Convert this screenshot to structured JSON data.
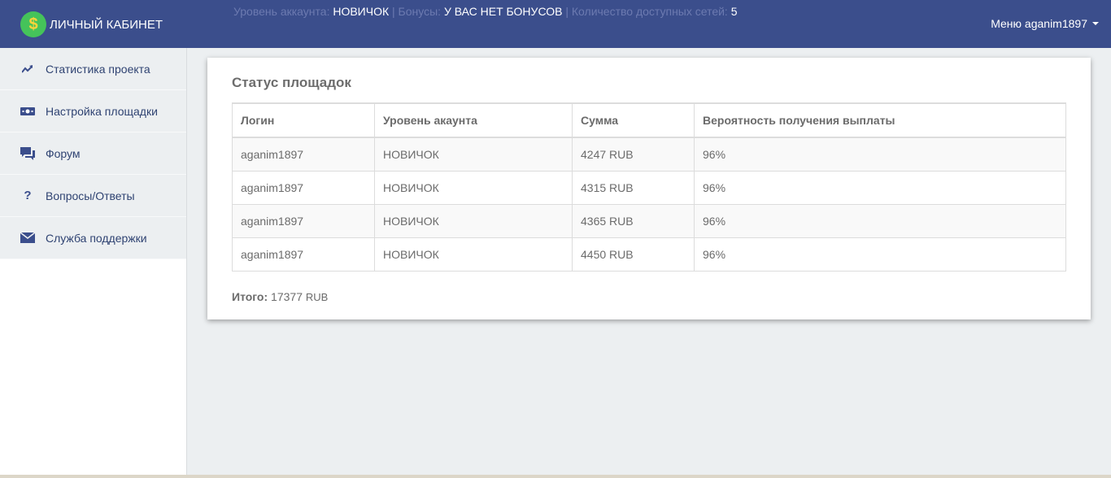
{
  "header": {
    "brand": "ЛИЧНЫЙ КАБИНЕТ",
    "brand_icon": "dollar-icon",
    "status": {
      "level_label": "Уровень аккаунта:",
      "level_value": "НОВИЧОК",
      "sep1": "|",
      "bonus_label": "Бонусы:",
      "bonus_value": "У ВАС НЕТ БОНУСОВ",
      "sep2": "|",
      "networks_label": "Количество доступных сетей:",
      "networks_value": "5"
    },
    "menu_label": "Меню aganim1897"
  },
  "sidebar": {
    "items": [
      {
        "label": "Статистика проекта",
        "icon": "trend-up-icon"
      },
      {
        "label": "Настройка площадки",
        "icon": "money-icon"
      },
      {
        "label": "Форум",
        "icon": "chat-icon"
      },
      {
        "label": "Вопросы/Ответы",
        "icon": "question-icon"
      },
      {
        "label": "Служба поддержки",
        "icon": "envelope-icon"
      }
    ]
  },
  "card": {
    "title": "Статус площадок",
    "columns": [
      "Логин",
      "Уровень акаунта",
      "Сумма",
      "Вероятность получения выплаты"
    ],
    "rows": [
      [
        "aganim1897",
        "НОВИЧОК",
        "4247 RUB",
        "96%"
      ],
      [
        "aganim1897",
        "НОВИЧОК",
        "4315 RUB",
        "96%"
      ],
      [
        "aganim1897",
        "НОВИЧОК",
        "4365 RUB",
        "96%"
      ],
      [
        "aganim1897",
        "НОВИЧОК",
        "4450 RUB",
        "96%"
      ]
    ],
    "total_label": "Итого:",
    "total_value": "17377",
    "total_currency": "RUB"
  },
  "colors": {
    "header_bg": "#3b4e8c",
    "sidebar_item_bg": "#eceff1",
    "brand_icon_bg": "#45c35a"
  }
}
